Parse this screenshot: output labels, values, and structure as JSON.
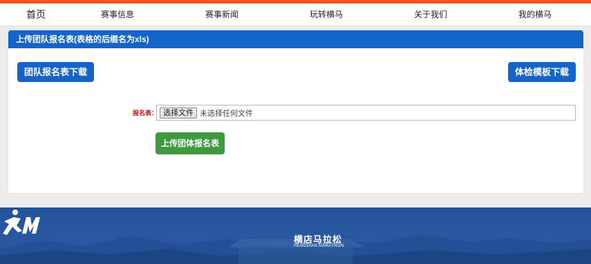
{
  "nav": {
    "items": [
      {
        "label": "首页"
      },
      {
        "label": "赛事信息"
      },
      {
        "label": "赛事新闻"
      },
      {
        "label": "玩转横马"
      },
      {
        "label": "关于我们"
      },
      {
        "label": "我的横马"
      }
    ]
  },
  "panel": {
    "title": "上传团队报名表(表格的后缀名为xls)",
    "team_download_label": "团队报名表下载",
    "medical_download_label": "体检模板下载",
    "field_label": "报名表：",
    "file_button_label": "选择文件",
    "file_status": "未选择任何文件",
    "upload_button_label": "上传团体报名表"
  },
  "footer": {
    "brand_cn": "横店马拉松",
    "brand_en": "HENGDIAN MARATHON"
  },
  "colors": {
    "accent_orange": "#e8461a",
    "primary_blue": "#1565c8",
    "upload_green": "#3f9a3f",
    "footer_blue": "#25549c"
  },
  "icons": {
    "logo": "runner-m-logo"
  }
}
